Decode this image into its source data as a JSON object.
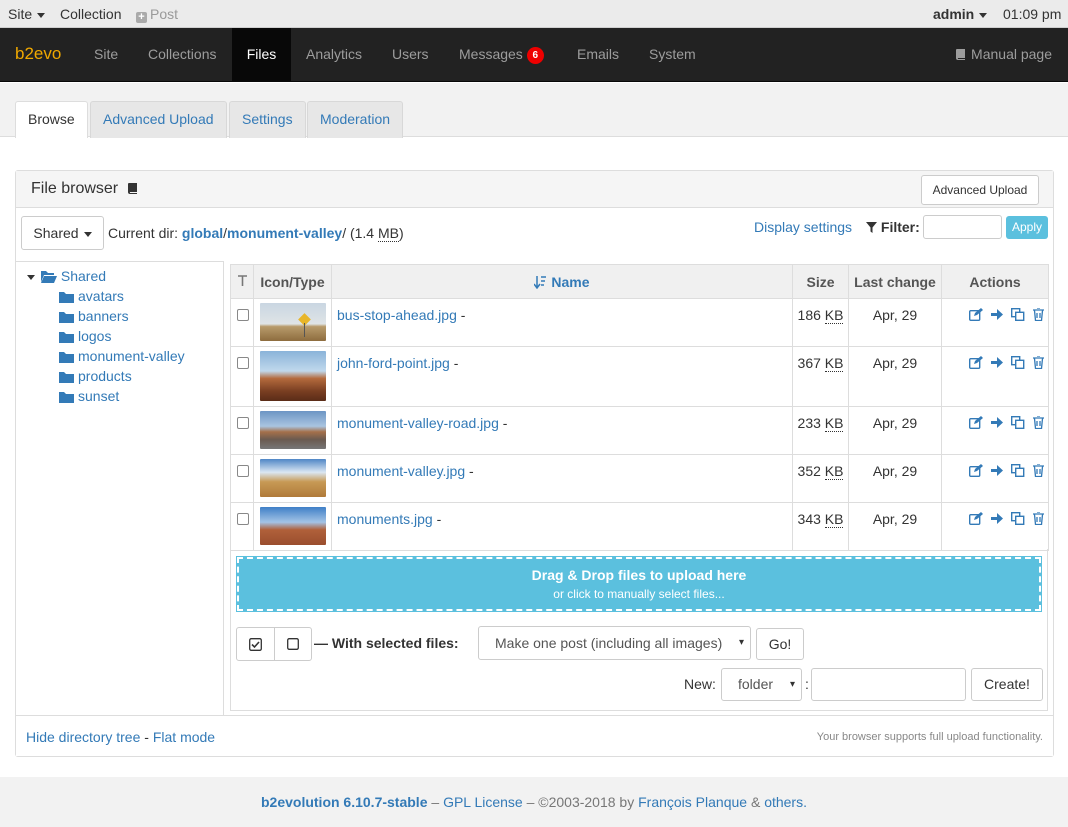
{
  "evobar": {
    "site": "Site",
    "collection": "Collection",
    "post": "Post",
    "user": "admin",
    "time": "01:09 pm"
  },
  "navbar": {
    "brand": "b2evo",
    "items": [
      "Site",
      "Collections",
      "Files",
      "Analytics",
      "Users",
      "Messages",
      "Emails",
      "System"
    ],
    "messages_badge": "6",
    "manual": "Manual page"
  },
  "subtabs": [
    "Browse",
    "Advanced Upload",
    "Settings",
    "Moderation"
  ],
  "panel": {
    "title": "File browser",
    "advanced_upload_btn": "Advanced Upload",
    "root_btn": "Shared",
    "current_dir_label": "Current dir:",
    "path_1": "global",
    "path_sep": "/",
    "path_2": "monument-valley",
    "path_end": "/",
    "size_open": "(1.4",
    "size_unit": "MB",
    "size_close": ")",
    "display_settings": "Display settings",
    "filter_label": "Filter:",
    "apply": "Apply"
  },
  "tree": {
    "root": "Shared",
    "items": [
      "avatars",
      "banners",
      "logos",
      "monument-valley",
      "products",
      "sunset"
    ]
  },
  "table": {
    "headers": {
      "icon_type": "Icon/Type",
      "name": "Name",
      "size": "Size",
      "last_change": "Last change",
      "actions": "Actions"
    },
    "rows": [
      {
        "name": "bus-stop-ahead.jpg",
        "dash": "-",
        "size": "186",
        "unit": "KB",
        "date": "Apr, 29"
      },
      {
        "name": "john-ford-point.jpg",
        "dash": "-",
        "size": "367",
        "unit": "KB",
        "date": "Apr, 29"
      },
      {
        "name": "monument-valley-road.jpg",
        "dash": "-",
        "size": "233",
        "unit": "KB",
        "date": "Apr, 29"
      },
      {
        "name": "monument-valley.jpg",
        "dash": "-",
        "size": "352",
        "unit": "KB",
        "date": "Apr, 29"
      },
      {
        "name": "monuments.jpg",
        "dash": "-",
        "size": "343",
        "unit": "KB",
        "date": "Apr, 29"
      }
    ]
  },
  "dropzone": {
    "title": "Drag & Drop files to upload here",
    "sub": "or click to manually select files..."
  },
  "selected": {
    "label": "— With selected files:",
    "action": "Make one post (including all images)",
    "go": "Go!"
  },
  "create": {
    "new_label": "New:",
    "type": "folder",
    "colon": ":",
    "button": "Create!"
  },
  "panel_footer": {
    "hide_tree": "Hide directory tree",
    "sep": "-",
    "flat_mode": "Flat mode",
    "support": "Your browser supports full upload functionality."
  },
  "footer": {
    "version": "b2evolution 6.10.7-stable",
    "dash1": "–",
    "license": "GPL License",
    "copyright": "– ©2003-2018 by",
    "author": "François Planque",
    "amp": "&",
    "others": "others."
  }
}
